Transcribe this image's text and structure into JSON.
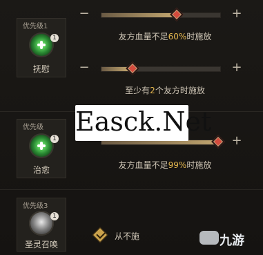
{
  "skills": [
    {
      "priority_label": "优先级1",
      "badge": "1",
      "name": "抚慰",
      "condition": {
        "prefix": "友方血量不足",
        "value": "60%",
        "suffix": "时施放",
        "slider_value": 0.6
      },
      "condition2": {
        "prefix": "至少有",
        "value": "2",
        "suffix": "个友方时施放",
        "slider_value": 0.2
      }
    },
    {
      "priority_label": "优先级",
      "badge": "1",
      "name": "治愈",
      "condition": {
        "prefix": "友方血量不足",
        "value": "99%",
        "suffix": "时施放",
        "slider_value": 0.99
      }
    },
    {
      "priority_label": "优先级3",
      "badge": "1",
      "name": "圣灵召唤",
      "checkbox_text": "从不施"
    }
  ],
  "controls": {
    "minus": "−",
    "plus": "+"
  },
  "watermarks": {
    "center_text": "Easck.Net",
    "corner_text": "九游"
  },
  "colors": {
    "accent": "#e6b84f",
    "knob": "#d44b3d",
    "icon_green": "#2a8a33"
  }
}
